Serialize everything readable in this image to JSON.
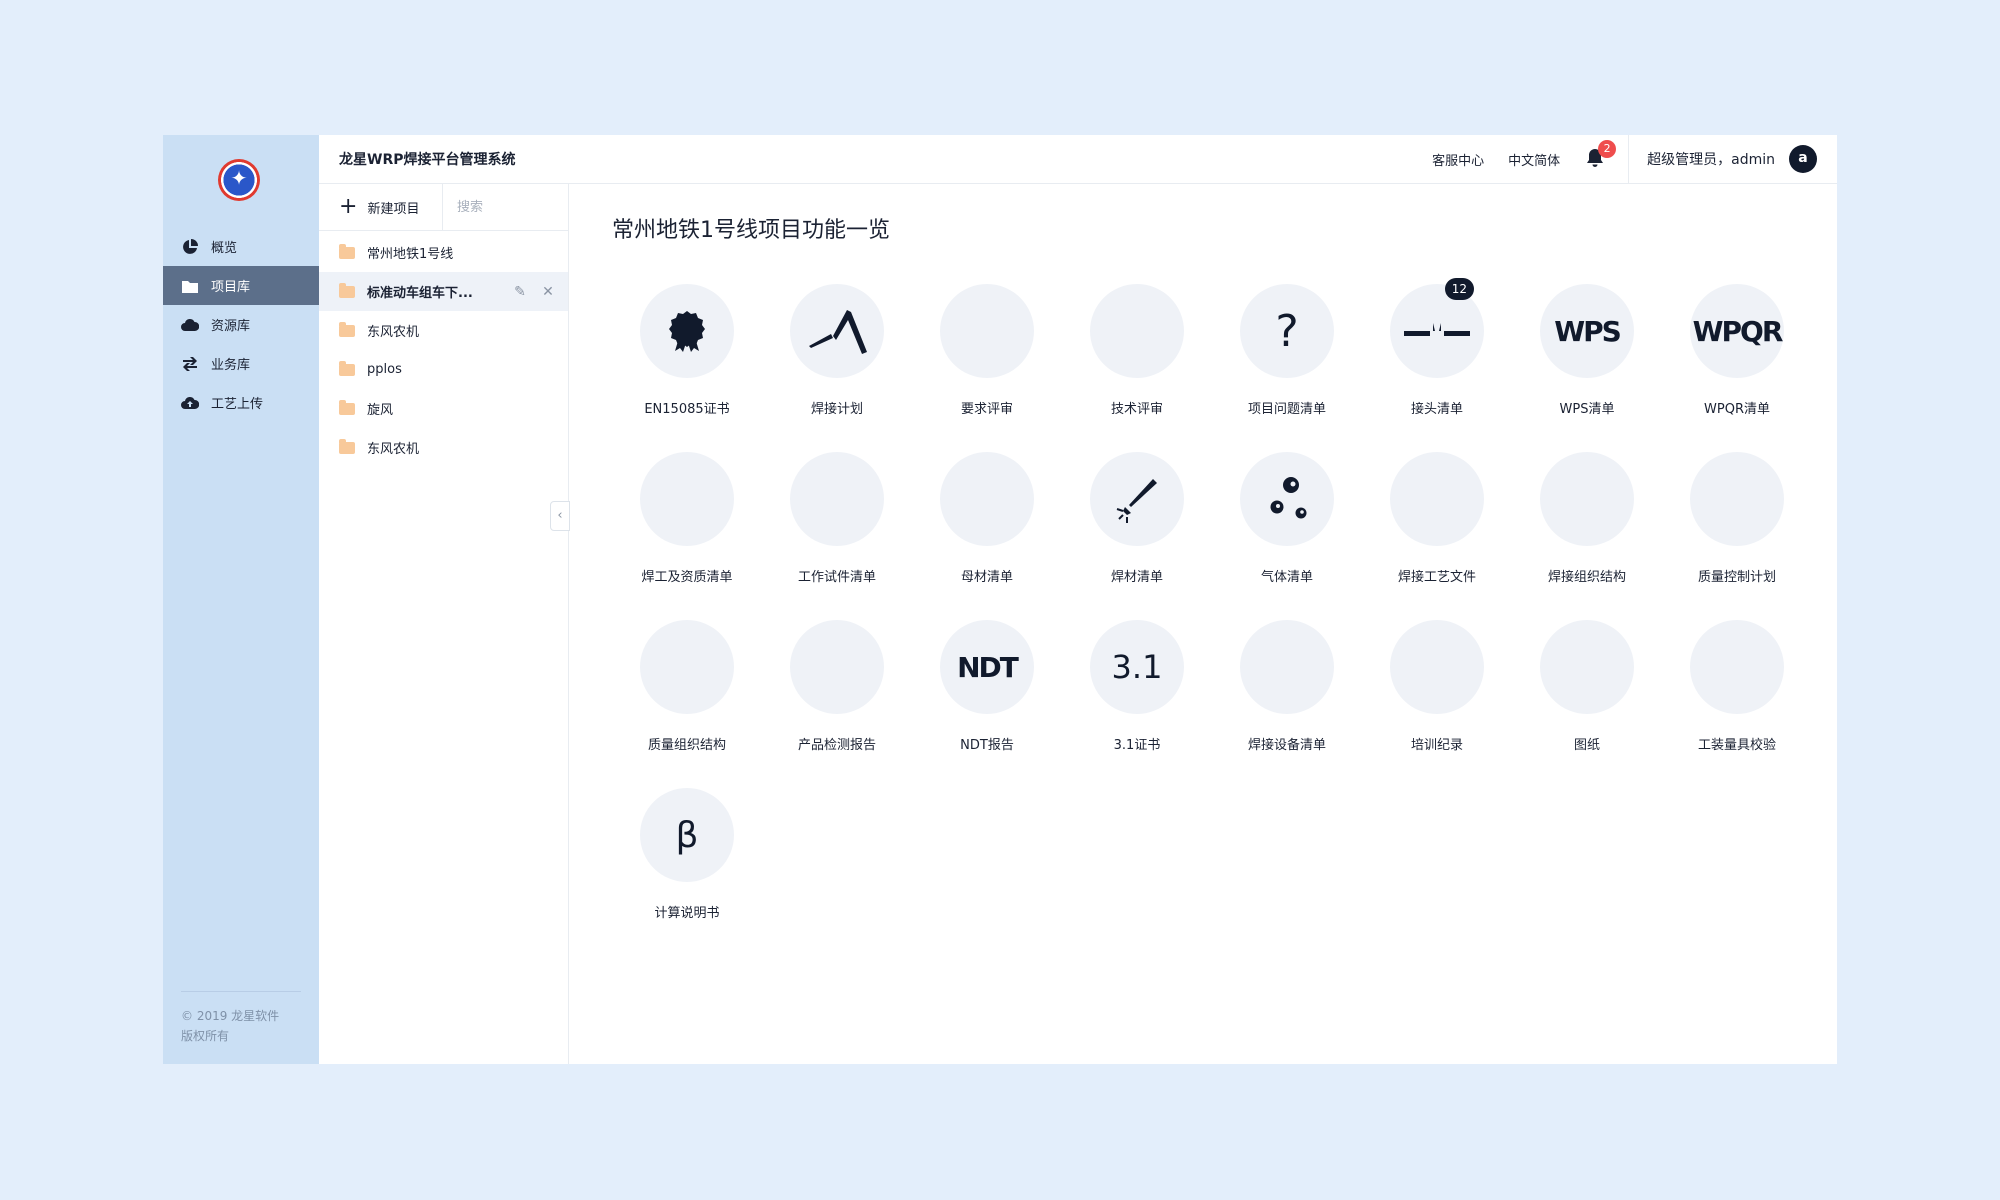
{
  "app": {
    "title": "龙星WRP焊接平台管理系统"
  },
  "sidebar": {
    "items": [
      {
        "label": "概览",
        "icon": "pie-chart-icon",
        "active": false
      },
      {
        "label": "项目库",
        "icon": "folder-icon",
        "active": true
      },
      {
        "label": "资源库",
        "icon": "cloud-icon",
        "active": false
      },
      {
        "label": "业务库",
        "icon": "swap-icon",
        "active": false
      },
      {
        "label": "工艺上传",
        "icon": "cloud-upload-icon",
        "active": false
      }
    ],
    "footer_line1": "© 2019 龙星软件",
    "footer_line2": "版权所有"
  },
  "header": {
    "service": "客服中心",
    "language": "中文简体",
    "notifications": "2",
    "user": "超级管理员，admin",
    "avatar_letter": "a"
  },
  "projects": {
    "new_label": "新建项目",
    "search_placeholder": "搜索",
    "items": [
      {
        "name": "常州地铁1号线"
      },
      {
        "name": "标准动车组车下..."
      },
      {
        "name": "东风农机"
      },
      {
        "name": "pplos"
      },
      {
        "name": "旋风"
      },
      {
        "name": "东风农机"
      }
    ]
  },
  "page": {
    "title": "常州地铁1号线项目功能一览",
    "tiles": [
      {
        "label": "EN15085证书",
        "icon": "certificate-icon"
      },
      {
        "label": "焊接计划",
        "icon": "welding-torch-icon"
      },
      {
        "label": "要求评审",
        "icon": "blank-icon"
      },
      {
        "label": "技术评审",
        "icon": "blank-icon"
      },
      {
        "label": "项目问题清单",
        "icon": "question-icon",
        "text": "?"
      },
      {
        "label": "接头清单",
        "icon": "joint-icon",
        "badge": "12"
      },
      {
        "label": "WPS清单",
        "icon": "wps-text-icon",
        "text": "WPS"
      },
      {
        "label": "WPQR清单",
        "icon": "wpqr-text-icon",
        "text": "WPQR"
      },
      {
        "label": "焊工及资质清单",
        "icon": "blank-icon"
      },
      {
        "label": "工作试件清单",
        "icon": "blank-icon"
      },
      {
        "label": "母材清单",
        "icon": "blank-icon"
      },
      {
        "label": "焊材清单",
        "icon": "welding-rod-icon"
      },
      {
        "label": "气体清单",
        "icon": "gas-bubbles-icon"
      },
      {
        "label": "焊接工艺文件",
        "icon": "blank-icon"
      },
      {
        "label": "焊接组织结构",
        "icon": "blank-icon"
      },
      {
        "label": "质量控制计划",
        "icon": "blank-icon"
      },
      {
        "label": "质量组织结构",
        "icon": "blank-icon"
      },
      {
        "label": "产品检测报告",
        "icon": "blank-icon"
      },
      {
        "label": "NDT报告",
        "icon": "ndt-text-icon",
        "text": "NDT"
      },
      {
        "label": "3.1证书",
        "icon": "cert-31-text-icon",
        "text": "3.1"
      },
      {
        "label": "焊接设备清单",
        "icon": "blank-icon"
      },
      {
        "label": "培训纪录",
        "icon": "blank-icon"
      },
      {
        "label": "图纸",
        "icon": "blank-icon"
      },
      {
        "label": "工装量具校验",
        "icon": "blank-icon"
      },
      {
        "label": "计算说明书",
        "icon": "beta-icon",
        "text": "β"
      }
    ]
  }
}
